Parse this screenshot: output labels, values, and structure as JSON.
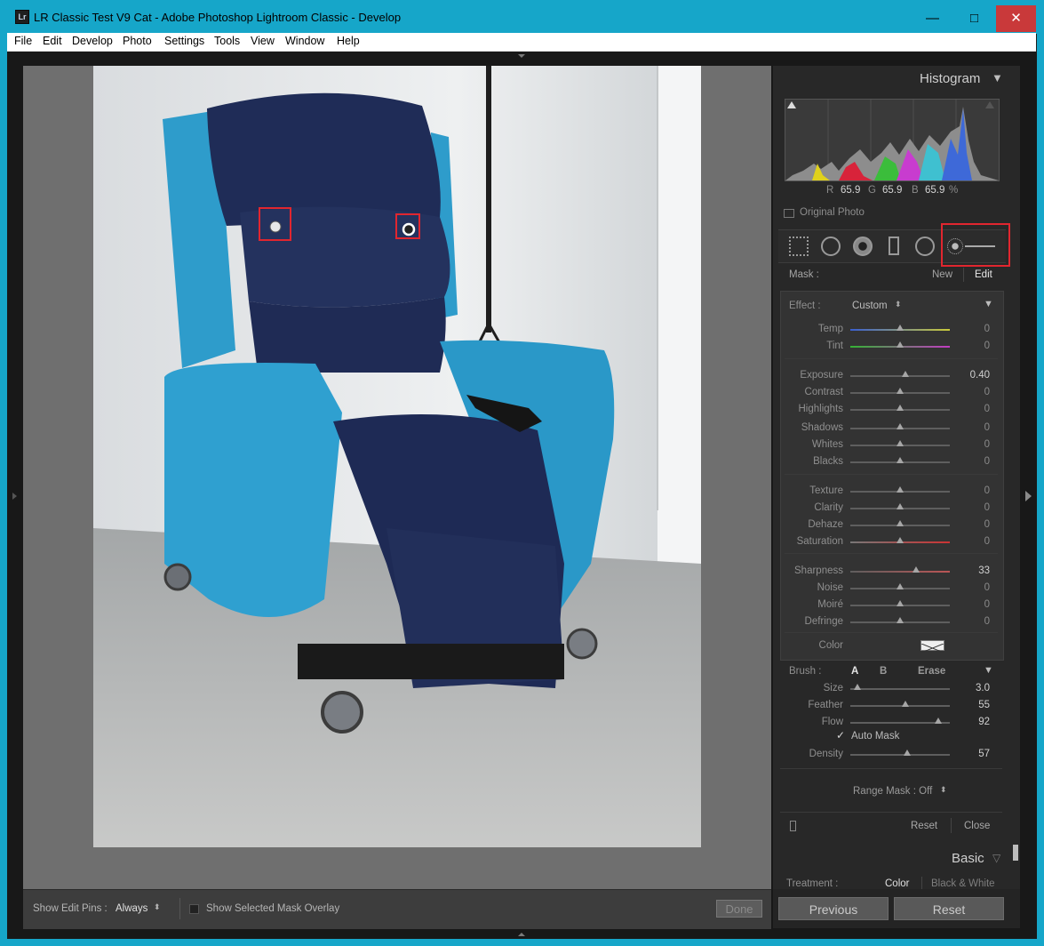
{
  "window": {
    "logo": "Lr",
    "title": "LR Classic Test V9 Cat - Adobe Photoshop Lightroom Classic - Develop",
    "minimize_symbol": "—",
    "maximize_symbol": "□",
    "close_symbol": "✕"
  },
  "menu": [
    "File",
    "Edit",
    "Develop",
    "Photo",
    "Settings",
    "Tools",
    "View",
    "Window",
    "Help"
  ],
  "histogram": {
    "header": "Histogram",
    "r_label": "R",
    "r_value": "65.9",
    "g_label": "G",
    "g_value": "65.9",
    "b_label": "B",
    "b_value": "65.9",
    "percent": "%",
    "original_photo": "Original Photo"
  },
  "mask": {
    "label": "Mask :",
    "new": "New",
    "edit": "Edit"
  },
  "effect": {
    "label": "Effect :",
    "value": "Custom",
    "sliders": [
      {
        "label": "Temp",
        "value": "0",
        "pos": 0.5
      },
      {
        "label": "Tint",
        "value": "0",
        "pos": 0.5
      },
      {
        "label": "Exposure",
        "value": "0.40",
        "pos": 0.55
      },
      {
        "label": "Contrast",
        "value": "0",
        "pos": 0.5
      },
      {
        "label": "Highlights",
        "value": "0",
        "pos": 0.5
      },
      {
        "label": "Shadows",
        "value": "0",
        "pos": 0.5
      },
      {
        "label": "Whites",
        "value": "0",
        "pos": 0.5
      },
      {
        "label": "Blacks",
        "value": "0",
        "pos": 0.5
      },
      {
        "label": "Texture",
        "value": "0",
        "pos": 0.5
      },
      {
        "label": "Clarity",
        "value": "0",
        "pos": 0.5
      },
      {
        "label": "Dehaze",
        "value": "0",
        "pos": 0.5
      },
      {
        "label": "Saturation",
        "value": "0",
        "pos": 0.5
      },
      {
        "label": "Sharpness",
        "value": "33",
        "pos": 0.66
      },
      {
        "label": "Noise",
        "value": "0",
        "pos": 0.5
      },
      {
        "label": "Moiré",
        "value": "0",
        "pos": 0.5
      },
      {
        "label": "Defringe",
        "value": "0",
        "pos": 0.5
      }
    ],
    "color_label": "Color"
  },
  "brush": {
    "label": "Brush :",
    "a": "A",
    "b": "B",
    "erase": "Erase",
    "sliders": [
      {
        "label": "Size",
        "value": "3.0",
        "pos": 0.07
      },
      {
        "label": "Feather",
        "value": "55",
        "pos": 0.55
      },
      {
        "label": "Flow",
        "value": "92",
        "pos": 0.88
      }
    ],
    "auto_mask": "Auto Mask",
    "density_label": "Density",
    "density_value": "57",
    "density_pos": 0.57
  },
  "range_mask": "Range Mask : Off",
  "reset": "Reset",
  "close": "Close",
  "basic": {
    "header": "Basic",
    "treatment_label": "Treatment :",
    "color": "Color",
    "bw": "Black & White"
  },
  "nav": {
    "previous": "Previous",
    "reset": "Reset"
  },
  "toolbar": {
    "show_edit_pins_label": "Show Edit Pins :",
    "show_edit_pins_value": "Always",
    "overlay_label": "Show Selected Mask Overlay",
    "done": "Done"
  },
  "colors": {
    "titlebar": "#16a6c9",
    "highlight": "#e1262f",
    "panel": "#282828"
  }
}
